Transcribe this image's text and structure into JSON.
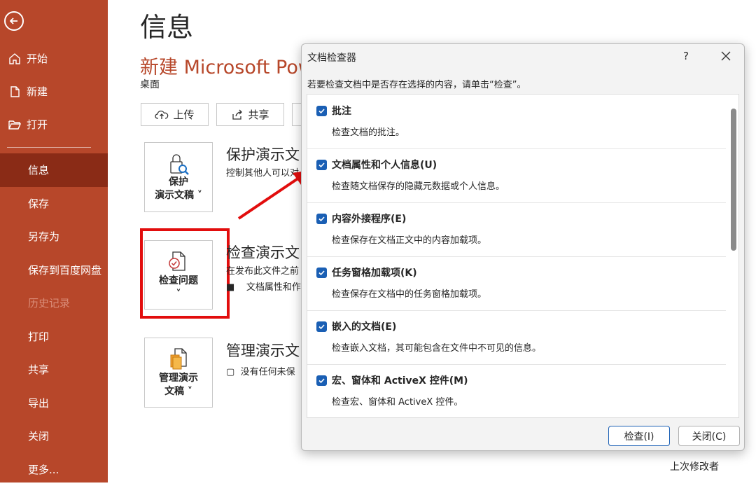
{
  "colors": {
    "accent": "#b7472a",
    "sidebar_active": "#8a2b16",
    "checkbox": "#1a5fb4",
    "highlight": "#e20d0d"
  },
  "sidebar": {
    "back_icon": "back-arrow-icon",
    "top_items": [
      {
        "label": "开始",
        "icon": "home-icon"
      },
      {
        "label": "新建",
        "icon": "new-doc-icon"
      },
      {
        "label": "打开",
        "icon": "folder-open-icon"
      }
    ],
    "items": [
      {
        "label": "信息",
        "active": true
      },
      {
        "label": "保存"
      },
      {
        "label": "另存为"
      },
      {
        "label": "保存到百度网盘"
      },
      {
        "label": "历史记录",
        "disabled": true
      },
      {
        "label": "打印"
      },
      {
        "label": "共享"
      },
      {
        "label": "导出"
      },
      {
        "label": "关闭"
      },
      {
        "label": "更多..."
      }
    ]
  },
  "main": {
    "title": "信息",
    "doc_title": "新建 Microsoft Pow",
    "doc_location": "桌面",
    "upload_label": "上传",
    "share_label": "共享",
    "protect": {
      "card_label_1": "保护",
      "card_label_2": "演示文稿",
      "title": "保护演示文",
      "desc": "控制其他人可以对"
    },
    "inspect": {
      "card_label": "检查问题",
      "title": "检查演示文",
      "desc": "在发布此文件之前",
      "bullet": "文档属性和作"
    },
    "manage": {
      "card_label_1": "管理演示",
      "card_label_2": "文稿",
      "title": "管理演示文",
      "desc": "没有任何未保"
    },
    "last_modified_by": "上次修改者"
  },
  "dialog": {
    "title": "文档检查器",
    "help": "?",
    "instruction": "若要检查文档中是否存在选择的内容，请单击“检查”。",
    "items": [
      {
        "label": "批注",
        "desc": "检查文档的批注。",
        "checked": true
      },
      {
        "label": "文档属性和个人信息(U)",
        "desc": "检查随文档保存的隐藏元数据或个人信息。",
        "checked": true
      },
      {
        "label": "内容外接程序(E)",
        "desc": "检查保存在文档正文中的内容加载项。",
        "checked": true
      },
      {
        "label": "任务窗格加载项(K)",
        "desc": "检查保存在文档中的任务窗格加载项。",
        "checked": true
      },
      {
        "label": "嵌入的文档(E)",
        "desc": "检查嵌入文档，其可能包含在文件中不可见的信息。",
        "checked": true
      },
      {
        "label": "宏、窗体和 ActiveX 控件(M)",
        "desc": "检查宏、窗体和 ActiveX 控件。",
        "checked": true
      }
    ],
    "inspect_button": "检查(I)",
    "close_button": "关闭(C)"
  }
}
